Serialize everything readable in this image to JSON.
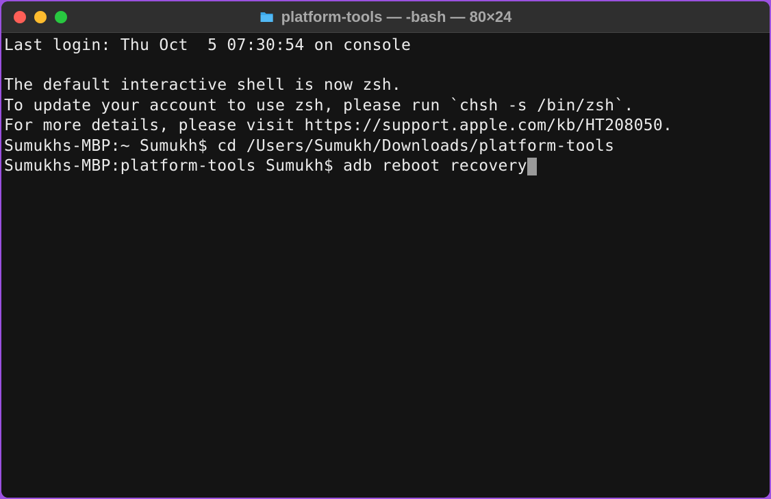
{
  "window": {
    "title": "platform-tools — -bash — 80×24"
  },
  "terminal": {
    "lines": {
      "last_login": "Last login: Thu Oct  5 07:30:54 on console",
      "zsh_notice_1": "The default interactive shell is now zsh.",
      "zsh_notice_2": "To update your account to use zsh, please run `chsh -s /bin/zsh`.",
      "zsh_notice_3": "For more details, please visit https://support.apple.com/kb/HT208050.",
      "prompt1": "Sumukhs-MBP:~ Sumukh$ ",
      "command1": "cd /Users/Sumukh/Downloads/platform-tools",
      "prompt2": "Sumukhs-MBP:platform-tools Sumukh$ ",
      "command2": "adb reboot recovery"
    }
  }
}
